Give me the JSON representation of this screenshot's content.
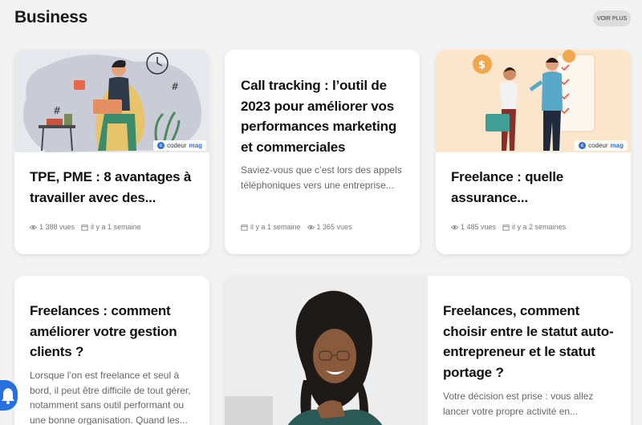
{
  "section": {
    "title": "Business",
    "more_label": "VOIR PLUS"
  },
  "badge": {
    "part1": "codeur",
    "part2": "mag"
  },
  "cards": [
    {
      "title": "TPE, PME : 8 avantages à travailler avec des...",
      "views": "1 388 vues",
      "date": "il y a 1 semaine"
    },
    {
      "title": "Call tracking : l’outil de 2023 pour améliorer vos performances marketing et commerciales",
      "excerpt": "Saviez-vous que c’est lors des appels téléphoniques vers une entreprise...",
      "date": "il y a 1 semaine",
      "views": "1 365 vues"
    },
    {
      "title": "Freelance : quelle assurance...",
      "views": "1 485 vues",
      "date": "il y a 2 semaines"
    },
    {
      "title": "Freelances : comment améliorer votre gestion clients ?",
      "excerpt": "Lorsque l’on est freelance et seul à bord, il peut être difficile de tout gérer, notamment sans outil performant ou une bonne organisation. Quand les..."
    },
    {
      "title": "Freelances, comment choisir entre le statut auto-entrepreneur et le statut portage ?",
      "excerpt": "Votre décision est prise : vous allez lancer votre propre activité en..."
    }
  ],
  "colors": {
    "background": "#f2f2f2",
    "accent": "#2870e0",
    "card": "#ffffff"
  }
}
